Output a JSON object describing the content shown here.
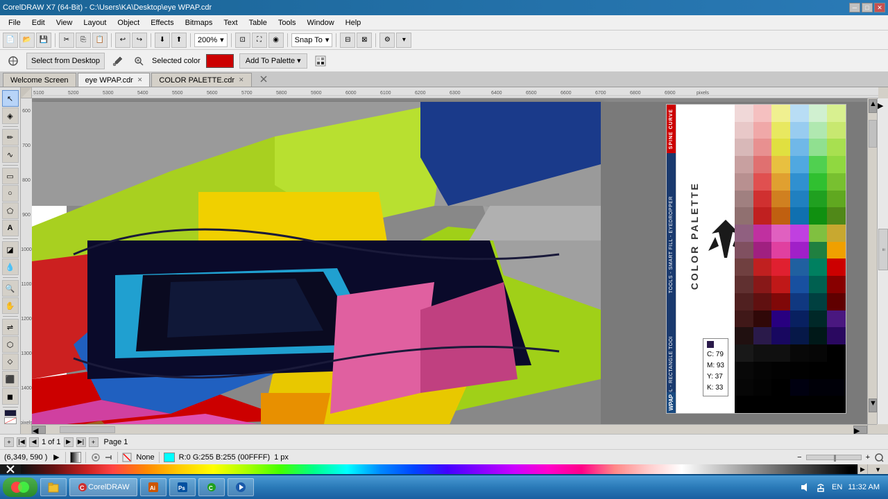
{
  "titlebar": {
    "title": "CorelDRAW X7 (64-Bit) - C:\\Users\\KA\\Desktop\\eye WPAP.cdr",
    "minimize": "─",
    "maximize": "□",
    "close": "✕"
  },
  "menubar": {
    "items": [
      "File",
      "Edit",
      "View",
      "Layout",
      "Object",
      "Effects",
      "Bitmaps",
      "Text",
      "Table",
      "Tools",
      "Window",
      "Help"
    ]
  },
  "toolbar1": {
    "zoom_level": "200%",
    "snap_to": "Snap To"
  },
  "toolbar2": {
    "select_from_desktop": "Select from Desktop",
    "selected_color_label": "Selected color",
    "add_to_palette": "Add To Palette ▾"
  },
  "tabs": [
    {
      "label": "Welcome Screen",
      "active": false,
      "closable": false
    },
    {
      "label": "eye WPAP.cdr",
      "active": true,
      "closable": true
    },
    {
      "label": "COLOR PALETTE.cdr",
      "active": false,
      "closable": true
    }
  ],
  "canvas": {
    "bg_color": "#7a7a7a"
  },
  "palette": {
    "title": "COLOR PALETTE",
    "side_label_red": "SPINE CURVE",
    "side_label_blue": "TOOLS - SMART FILL - EYEDROPPER",
    "side_label_blue2": "PEN TOOL - RECTANGLE TOOL - BASIC",
    "side_label_bottom": "WPAP"
  },
  "cmyk_tooltip": {
    "c": "79",
    "m": "93",
    "y": "37",
    "k": "33"
  },
  "statusbar": {
    "coordinates": "(6,349, 590 )",
    "snap_icon": "◈",
    "fill_none": "None",
    "color_info": "R:0 G:255 B:255 (00FFFF)",
    "px": "1 px",
    "page": "1 of 1",
    "page_label": "Page 1",
    "time": "11:32 AM",
    "lang": "EN"
  },
  "swatches": {
    "rows": [
      [
        "#f0d0d0",
        "#f5b0b0",
        "#f0f0a0",
        "#b0d8f5",
        "#d0f0d0",
        "#d0f0a0"
      ],
      [
        "#e0c0c0",
        "#f0a0a0",
        "#e8e870",
        "#90c8f0",
        "#b0e8b0",
        "#c0e880"
      ],
      [
        "#d0b0b0",
        "#e89090",
        "#e0e050",
        "#70b8e8",
        "#90e090",
        "#a8e060"
      ],
      [
        "#c0a0a0",
        "#e07070",
        "#e8c050",
        "#50a8e0",
        "#50d050",
        "#90d840"
      ],
      [
        "#b09090",
        "#e05050",
        "#e0a030",
        "#3090d0",
        "#30c030",
        "#78c030"
      ],
      [
        "#a08080",
        "#d03030",
        "#d08020",
        "#2080c0",
        "#20a020",
        "#60a820"
      ],
      [
        "#907070",
        "#c02020",
        "#c06010",
        "#1070b0",
        "#109010",
        "#508818"
      ],
      [
        "#806060",
        "#b01010",
        "#b04000",
        "#0060a0",
        "#008000",
        "#387010"
      ],
      [
        "#705050",
        "#900000",
        "#903000",
        "#0050904",
        "#007000",
        "#286008"
      ],
      [
        "#604040",
        "#700000",
        "#702000",
        "#003070",
        "#005000",
        "#184800"
      ],
      [
        "#503030",
        "#500000",
        "#501000",
        "#002060",
        "#003000",
        "#0c3000"
      ],
      [
        "#402020",
        "#300000",
        "#300000",
        "#001050",
        "#002000",
        "#042000"
      ],
      [
        "#200000",
        "#100000",
        "#000000",
        "#000040",
        "#001000",
        "#001000"
      ]
    ]
  },
  "icons": {
    "eyedropper": "💉",
    "arrow": "↖",
    "zoom": "🔍",
    "pen": "✒",
    "rect": "▭",
    "text_tool": "A",
    "fill": "🪣",
    "shape": "⬠"
  }
}
